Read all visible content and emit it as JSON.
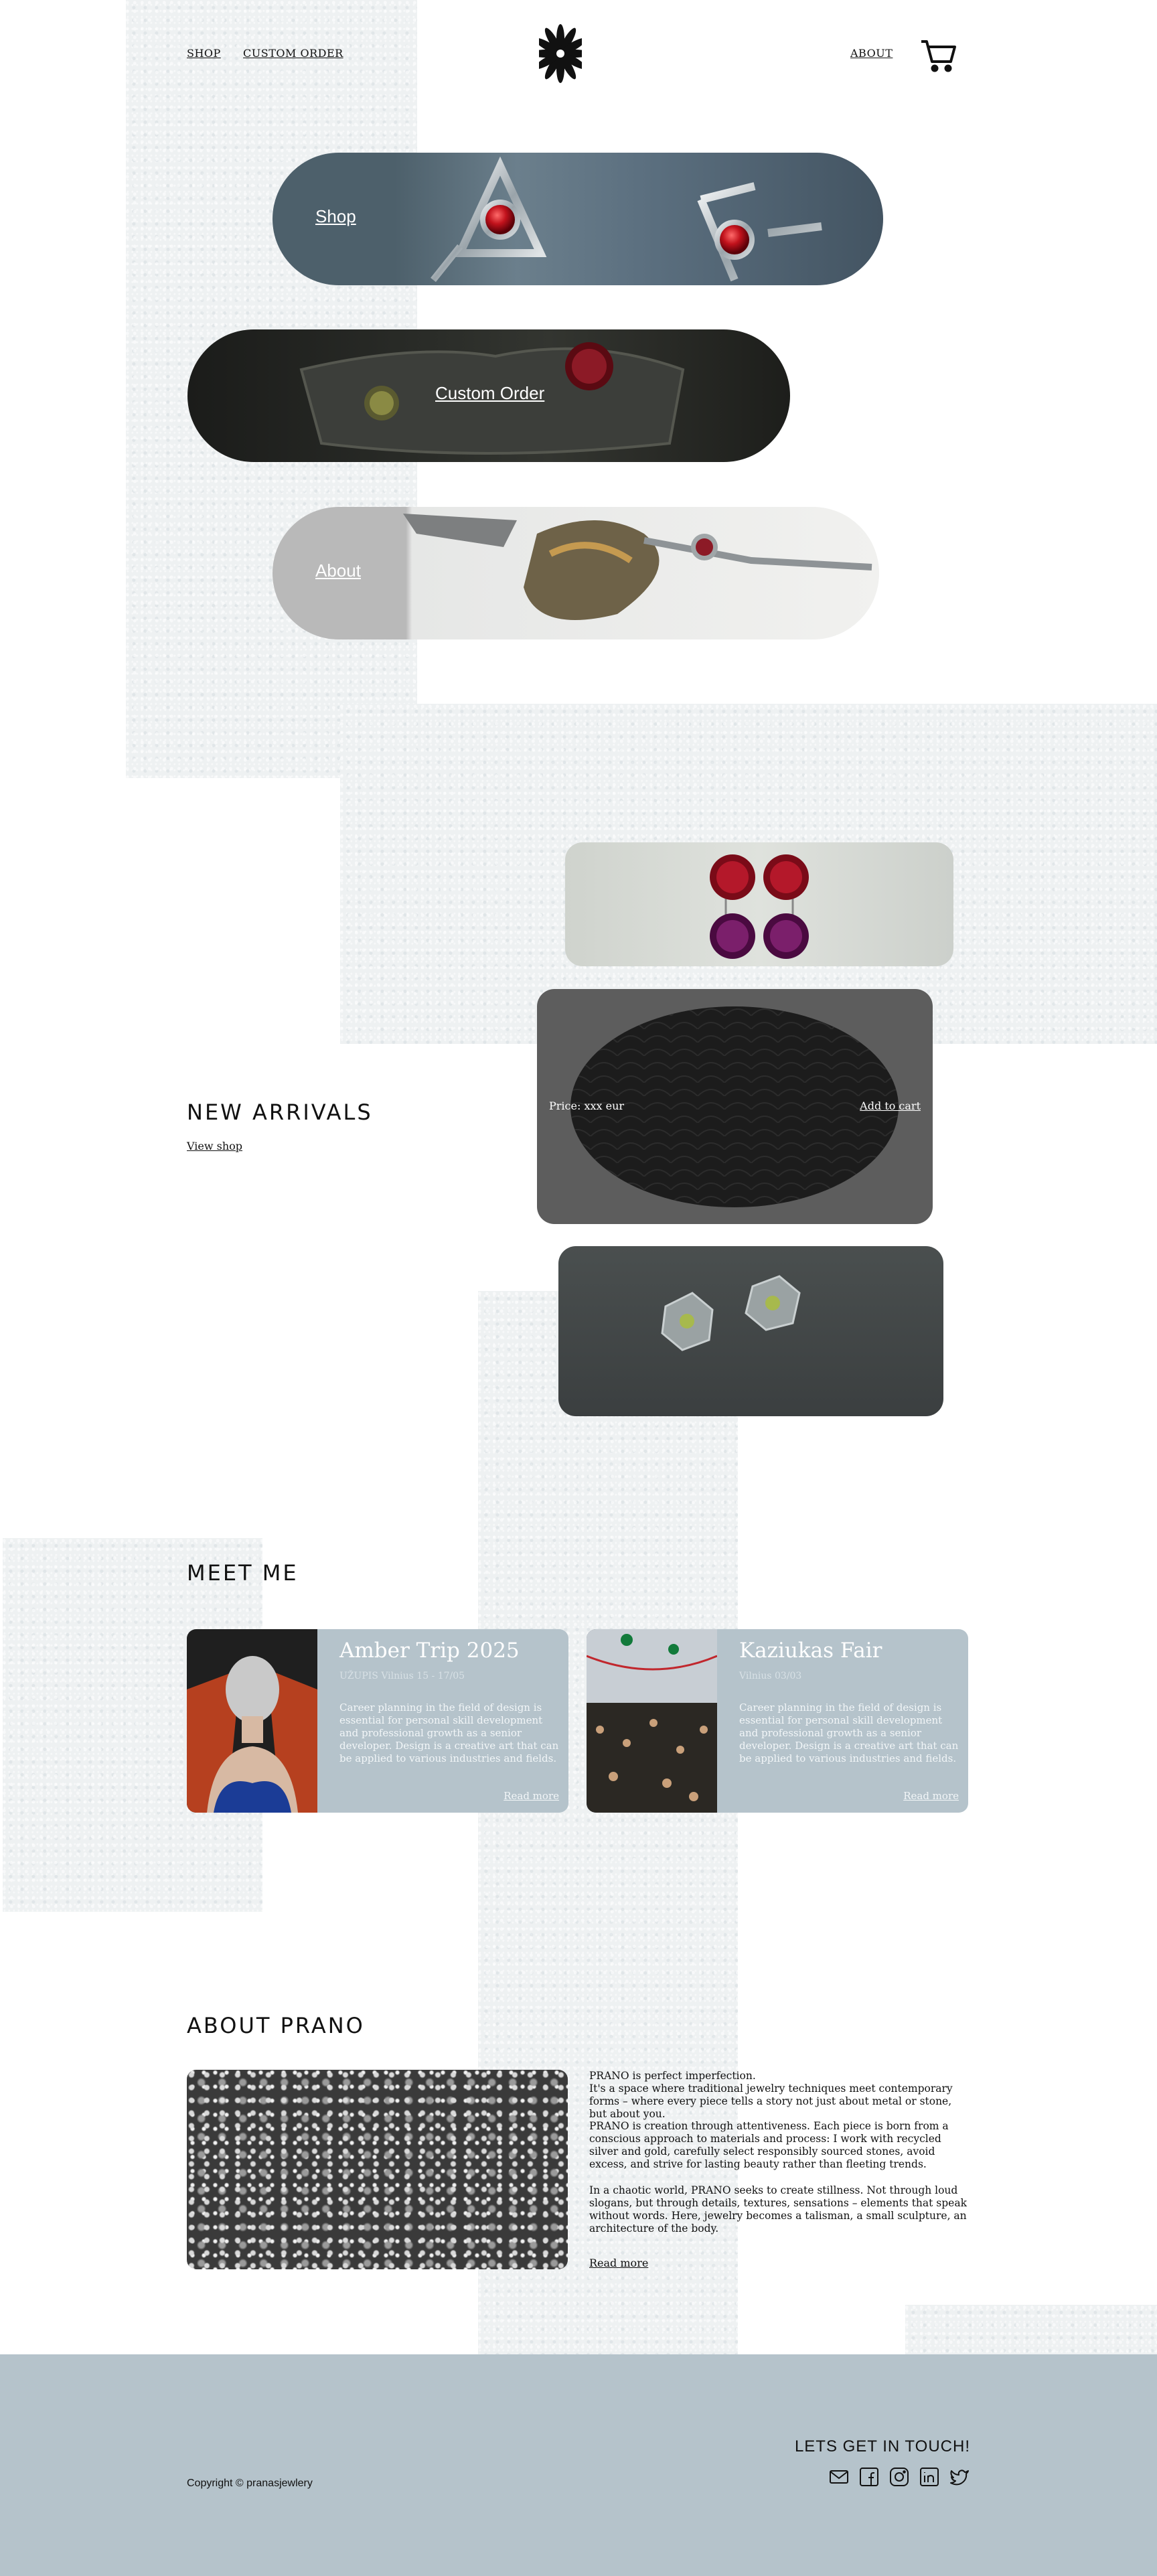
{
  "header": {
    "nav_shop": "SHOP",
    "nav_custom": "CUSTOM ORDER",
    "nav_about": "ABOUT",
    "logo_icon": "flower-logo-icon",
    "cart_icon": "cart-icon"
  },
  "hero": {
    "shop_label": "Shop",
    "custom_label": "Custom Order",
    "about_label": "About"
  },
  "new_arrivals": {
    "title": "NEW ARRIVALS",
    "view_shop": "View shop",
    "price": "Price: xxx eur",
    "add_to_cart": "Add to cart"
  },
  "meet_me": {
    "title": "MEET ME",
    "events": [
      {
        "title": "Amber Trip 2025",
        "subtitle": "UŽUPIS Vilnius 15 - 17/05",
        "text": "Career planning in the field of design is essential for personal skill development and professional growth as a senior developer. Design is a creative art that can be applied to various industries and fields.",
        "more": "Read more"
      },
      {
        "title": "Kaziukas Fair",
        "subtitle": "Vilnius 03/03",
        "text": "Career planning in the field of design is essential for personal skill development and professional growth as a senior developer. Design is a creative art that can be applied to various industries and fields.",
        "more": "Read more"
      }
    ]
  },
  "about": {
    "title": "ABOUT PRANO",
    "p1a": "PRANO is perfect imperfection.",
    "p1b": "It's a space where traditional jewelry techniques meet contemporary forms – where every piece tells a story not just about metal or stone, but about you.",
    "p2": "PRANO is creation through attentiveness. Each piece is born from a conscious approach to materials and process: I work with recycled silver and gold, carefully select responsibly sourced stones, avoid excess, and strive for lasting beauty rather than fleeting trends.",
    "p3": "In a chaotic world, PRANO seeks to create stillness. Not through loud slogans, but through details, textures, sensations – elements that speak without words. Here, jewelry becomes a talisman, a small sculpture, an architecture of the body.",
    "more": "Read more"
  },
  "footer": {
    "copyright": "Copyright © pranasjewlery",
    "contact": "LETS GET IN TOUCH!",
    "icons": [
      "mail-icon",
      "facebook-icon",
      "instagram-icon",
      "linkedin-icon",
      "twitter-icon"
    ]
  },
  "colors": {
    "card_blue": "#b5c3cb",
    "footer_bg": "#b5c3cb"
  }
}
